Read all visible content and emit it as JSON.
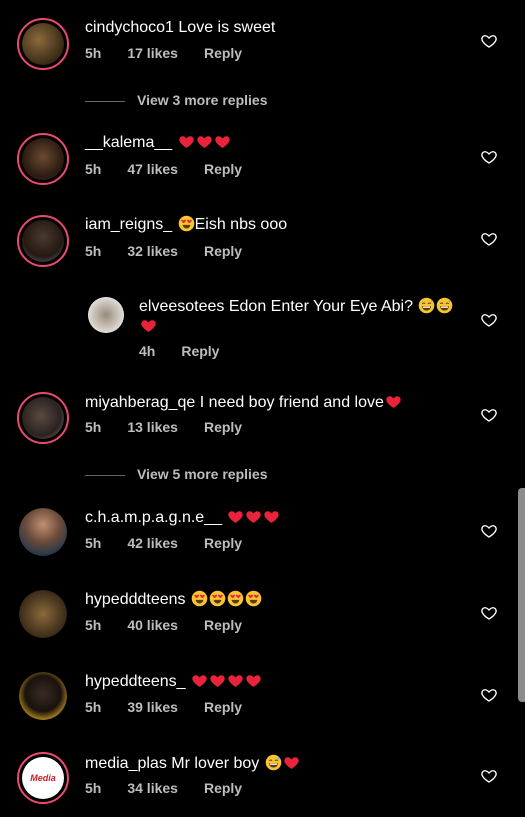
{
  "comments": [
    {
      "user": "cindychoco1",
      "text": "Love is sweet",
      "time": "5h",
      "likes": "17 likes",
      "reply": "Reply"
    },
    {
      "user": "__kalema__",
      "text": "",
      "time": "5h",
      "likes": "47 likes",
      "reply": "Reply"
    },
    {
      "user": "iam_reigns_",
      "text": "Eish nbs ooo",
      "time": "5h",
      "likes": "32 likes",
      "reply": "Reply"
    },
    {
      "user": "elveesotees",
      "text": "Edon Enter Your Eye Abi?",
      "time": "4h",
      "reply": "Reply"
    },
    {
      "user": "miyahberag_qe",
      "text": "I need boy friend and love",
      "time": "5h",
      "likes": "13 likes",
      "reply": "Reply"
    },
    {
      "user": "c.h.a.m.p.a.g.n.e__",
      "text": "",
      "time": "5h",
      "likes": "42 likes",
      "reply": "Reply"
    },
    {
      "user": "hypedddteens",
      "text": "",
      "time": "5h",
      "likes": "40 likes",
      "reply": "Reply"
    },
    {
      "user": "hypeddteens_",
      "text": "",
      "time": "5h",
      "likes": "39 likes",
      "reply": "Reply"
    },
    {
      "user": "media_plas",
      "text": "Mr lover boy",
      "time": "5h",
      "likes": "34 likes",
      "reply": "Reply"
    }
  ],
  "view_more": [
    "View 3 more replies",
    "View 5 more replies"
  ],
  "media_logo_text": "Media",
  "colors": {
    "background": "#000000",
    "heart_emoji": "#e8233a",
    "story_ring": "#e94a6d",
    "meta": "#bdbdbd"
  },
  "icons": {
    "like": "heart-outline-icon",
    "emoji_heart": "red-heart-emoji",
    "emoji_laugh": "grinning-sweat-emoji",
    "emoji_heart_eyes": "heart-eyes-emoji"
  }
}
